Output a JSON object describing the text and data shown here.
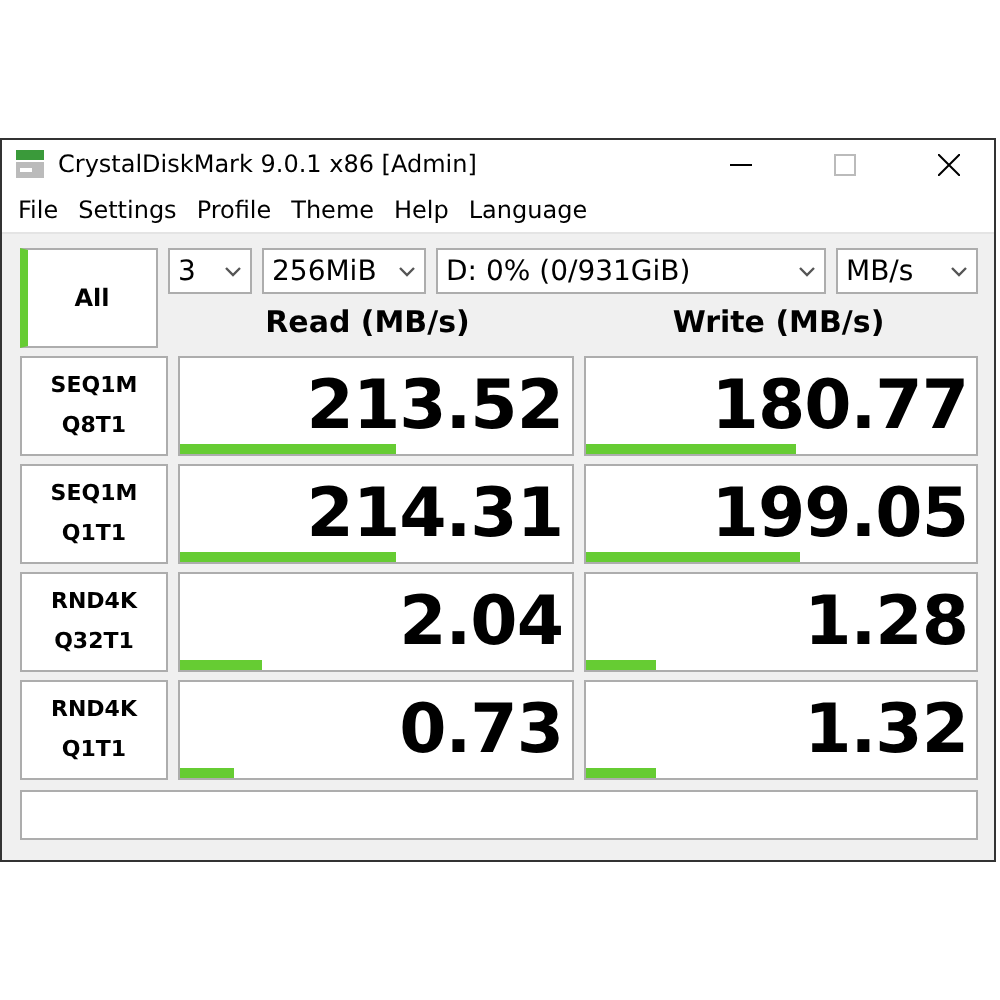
{
  "window": {
    "title": "CrystalDiskMark 9.0.1 x86 [Admin]"
  },
  "menu": [
    "File",
    "Settings",
    "Profile",
    "Theme",
    "Help",
    "Language"
  ],
  "all_button": {
    "label": "All"
  },
  "selectors": [
    {
      "value": "3"
    },
    {
      "value": "256MiB"
    },
    {
      "value": "D: 0% (0/931GiB)"
    },
    {
      "value": "MB/s"
    }
  ],
  "columns": [
    "Read (MB/s)",
    "Write (MB/s)"
  ],
  "rows": [
    {
      "test": [
        "SEQ1M",
        "Q8T1"
      ],
      "read": {
        "value": "213.52",
        "level": 0.55
      },
      "write": {
        "value": "180.77",
        "level": 0.54
      }
    },
    {
      "test": [
        "SEQ1M",
        "Q1T1"
      ],
      "read": {
        "value": "214.31",
        "level": 0.55
      },
      "write": {
        "value": "199.05",
        "level": 0.55
      }
    },
    {
      "test": [
        "RND4K",
        "Q32T1"
      ],
      "read": {
        "value": "2.04",
        "level": 0.21
      },
      "write": {
        "value": "1.28",
        "level": 0.18
      }
    },
    {
      "test": [
        "RND4K",
        "Q1T1"
      ],
      "read": {
        "value": "0.73",
        "level": 0.14
      },
      "write": {
        "value": "1.32",
        "level": 0.18
      }
    }
  ]
}
